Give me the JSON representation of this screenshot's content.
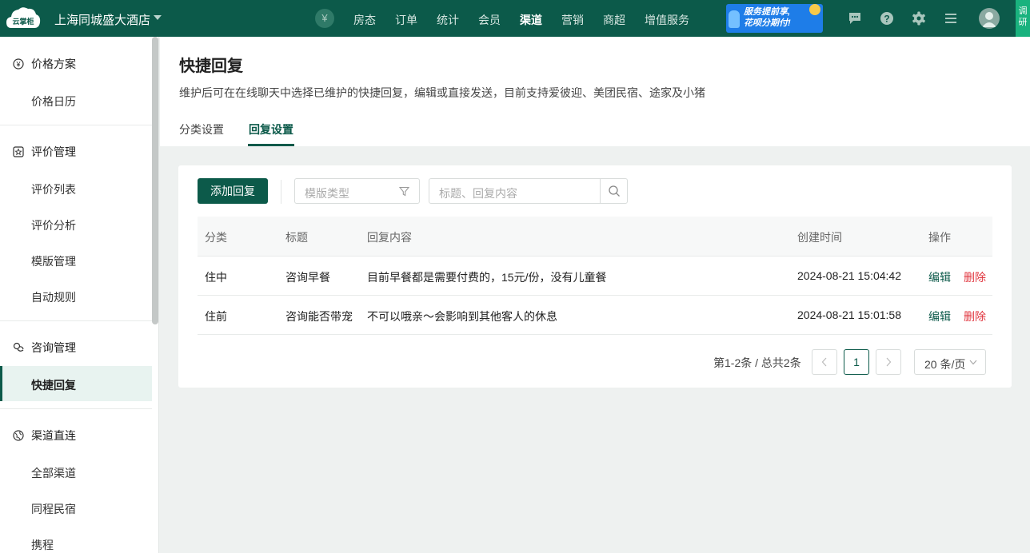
{
  "topbar": {
    "logo_text": "云掌柜",
    "hotel_name": "上海同城盛大酒店",
    "nav": [
      "房态",
      "订单",
      "统计",
      "会员",
      "渠道",
      "营销",
      "商超",
      "增值服务"
    ],
    "active_nav": "渠道",
    "promo_line1": "服务提前享,",
    "promo_line2": "花呗分期付!",
    "side_tag": "调研",
    "colors": {
      "bar": "#0c5a4a",
      "promo": "#1e7de8"
    }
  },
  "sidebar": {
    "groups": [
      {
        "label": "价格方案",
        "icon": "yen-circle-icon",
        "items": [
          "价格日历"
        ]
      },
      {
        "label": "评价管理",
        "icon": "star-square-icon",
        "items": [
          "评价列表",
          "评价分析",
          "模版管理",
          "自动规则"
        ]
      },
      {
        "label": "咨询管理",
        "icon": "chat-icon",
        "items": [
          "快捷回复"
        ]
      },
      {
        "label": "渠道直连",
        "icon": "globe-icon",
        "items": [
          "全部渠道",
          "同程民宿",
          "携程"
        ]
      }
    ],
    "selected": "快捷回复"
  },
  "page": {
    "title": "快捷回复",
    "desc": "维护后可在在线聊天中选择已维护的快捷回复，编辑或直接发送，目前支持爱彼迎、美团民宿、途家及小猪",
    "tabs": [
      "分类设置",
      "回复设置"
    ],
    "active_tab": "回复设置"
  },
  "toolbar": {
    "add_label": "添加回复",
    "type_placeholder": "模版类型",
    "search_placeholder": "标题、回复内容"
  },
  "table": {
    "headers": [
      "分类",
      "标题",
      "回复内容",
      "创建时间",
      "操作"
    ],
    "rows": [
      {
        "category": "住中",
        "title": "咨询早餐",
        "content": "目前早餐都是需要付费的，15元/份，没有儿童餐",
        "created": "2024-08-21 15:04:42"
      },
      {
        "category": "住前",
        "title": "咨询能否带宠",
        "content": "不可以哦亲～会影响到其他客人的休息",
        "created": "2024-08-21 15:01:58"
      }
    ],
    "action_edit": "编辑",
    "action_delete": "删除"
  },
  "pagination": {
    "summary": "第1-2条 / 总共2条",
    "prev": "<",
    "current_page": "1",
    "next": ">",
    "page_size": "20 条/页"
  }
}
